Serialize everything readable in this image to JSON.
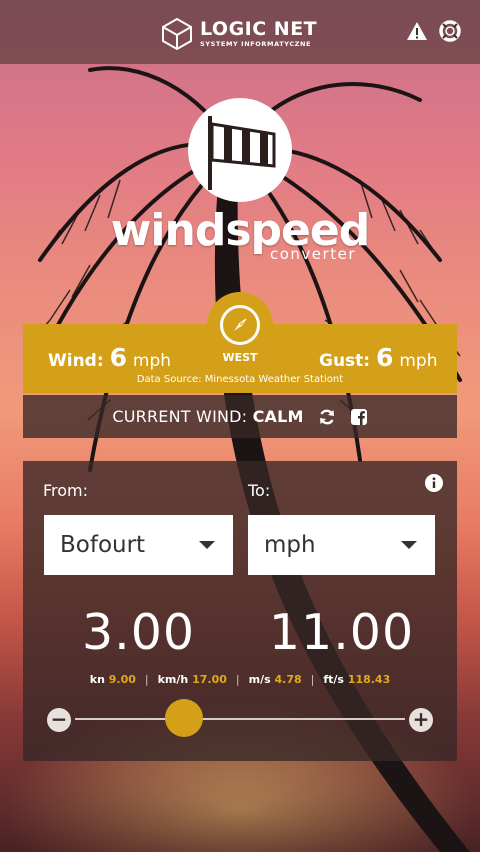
{
  "header": {
    "brand_name": "LOGIC NET",
    "brand_sub": "SYSTEMY INFORMATYCZNE",
    "icons": [
      "warning-icon",
      "lifebuoy-icon"
    ]
  },
  "logo": {
    "title": "windspeed",
    "subtitle": "converter",
    "icon": "windsock-icon"
  },
  "wind": {
    "wind_label": "Wind:",
    "wind_value": "6",
    "wind_unit": "mph",
    "direction": "WEST",
    "gust_label": "Gust:",
    "gust_value": "6",
    "gust_unit": "mph",
    "source": "Data Source: Minessota Weather Stationt",
    "accent": "#d4a01a"
  },
  "current": {
    "label": "CURRENT WIND:",
    "value": "CALM"
  },
  "converter": {
    "from_label": "From:",
    "to_label": "To:",
    "from_unit": "Bofourt",
    "to_unit": "mph",
    "from_value": "3.00",
    "to_value": "11.00",
    "units": [
      {
        "name": "kn",
        "value": "9.00"
      },
      {
        "name": "km/h",
        "value": "17.00"
      },
      {
        "name": "m/s",
        "value": "4.78"
      },
      {
        "name": "ft/s",
        "value": "118.43"
      }
    ],
    "minus": "−",
    "plus": "+",
    "slider_level": 0.33
  }
}
